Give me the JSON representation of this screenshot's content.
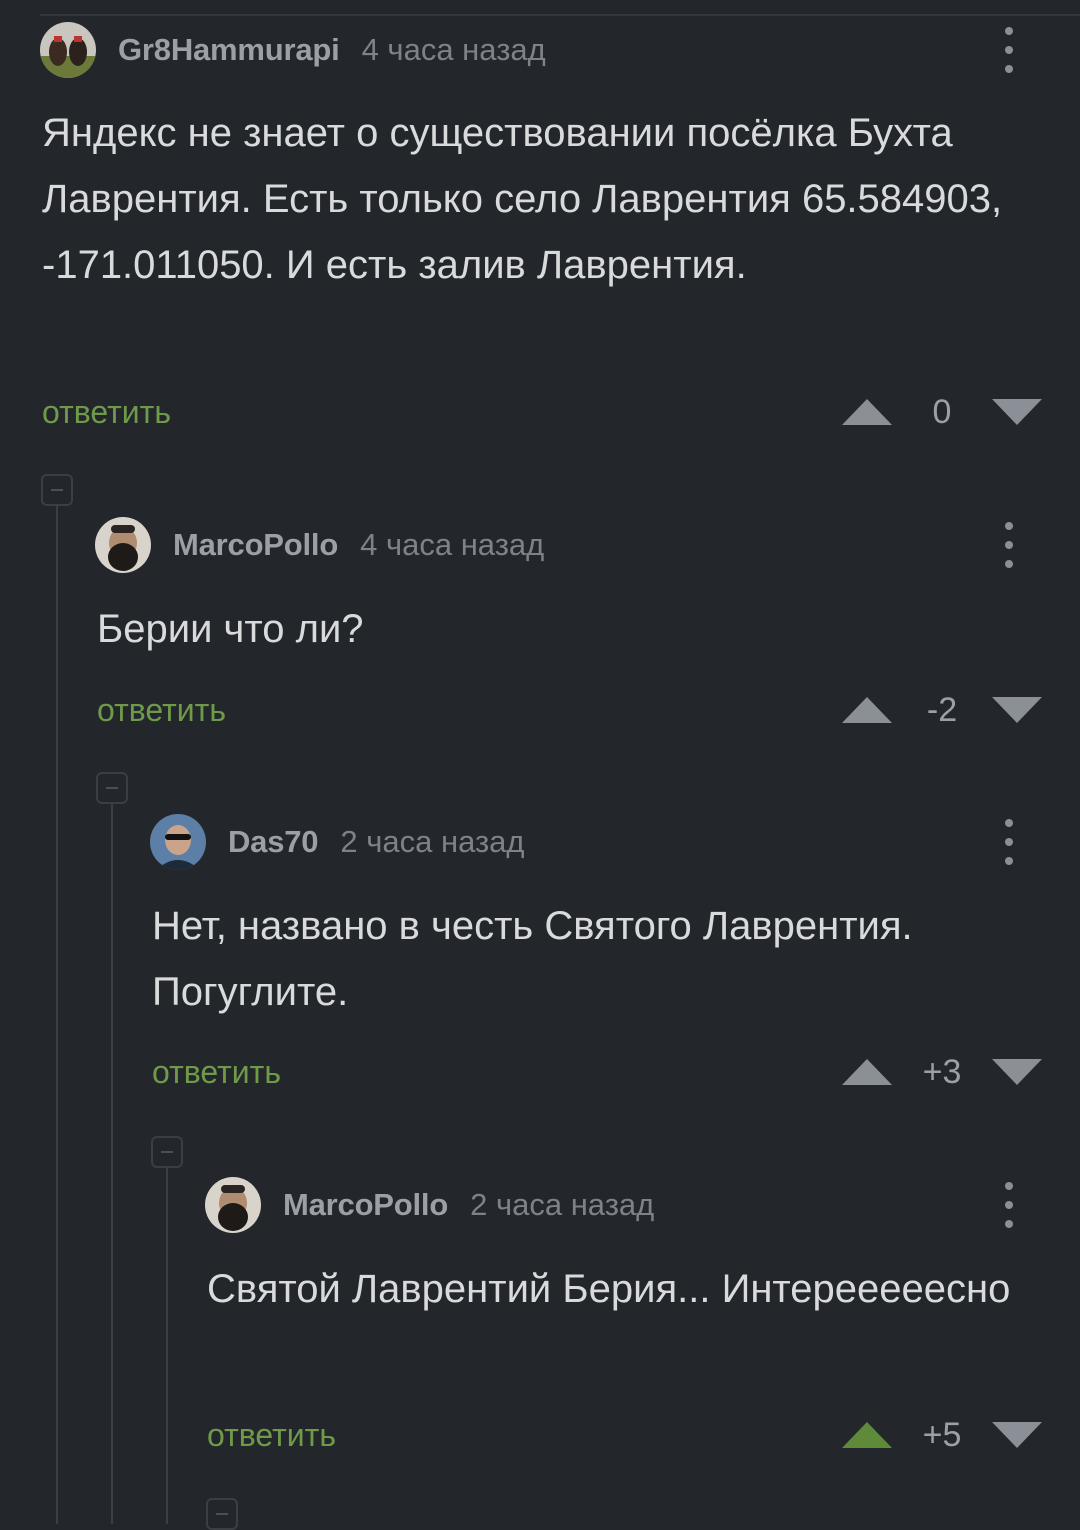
{
  "comments": [
    {
      "username": "Gr8Hammurapi",
      "time": "4 часа назад",
      "text": "Яндекс не знает о существовании посёлка Бухта Лаврентия. Есть только село Лаврентия 65.584903, -171.011050. И есть залив Лаврентия.",
      "reply_label": "ответить",
      "score": "0",
      "upvoted": false
    },
    {
      "username": "MarcoPollo",
      "time": "4 часа назад",
      "text": "Берии что ли?",
      "reply_label": "ответить",
      "score": "-2",
      "upvoted": false
    },
    {
      "username": "Das70",
      "time": "2 часа назад",
      "text": "Нет, названо в честь Святого Лаврентия. Погуглите.",
      "reply_label": "ответить",
      "score": "+3",
      "upvoted": false
    },
    {
      "username": "MarcoPollo",
      "time": "2 часа назад",
      "text": "Святой Лаврентий Берия... Интерееееесно",
      "reply_label": "ответить",
      "score": "+5",
      "upvoted": true
    }
  ],
  "icons": {
    "more": "more-vertical-icon",
    "upvote": "upvote-arrow-icon",
    "downvote": "downvote-arrow-icon",
    "collapse": "collapse-thread-icon"
  },
  "colors": {
    "background": "#23272b",
    "reply_link": "#6e9a4a",
    "upvote_active": "#5e8a3a",
    "muted": "#8a9095"
  }
}
